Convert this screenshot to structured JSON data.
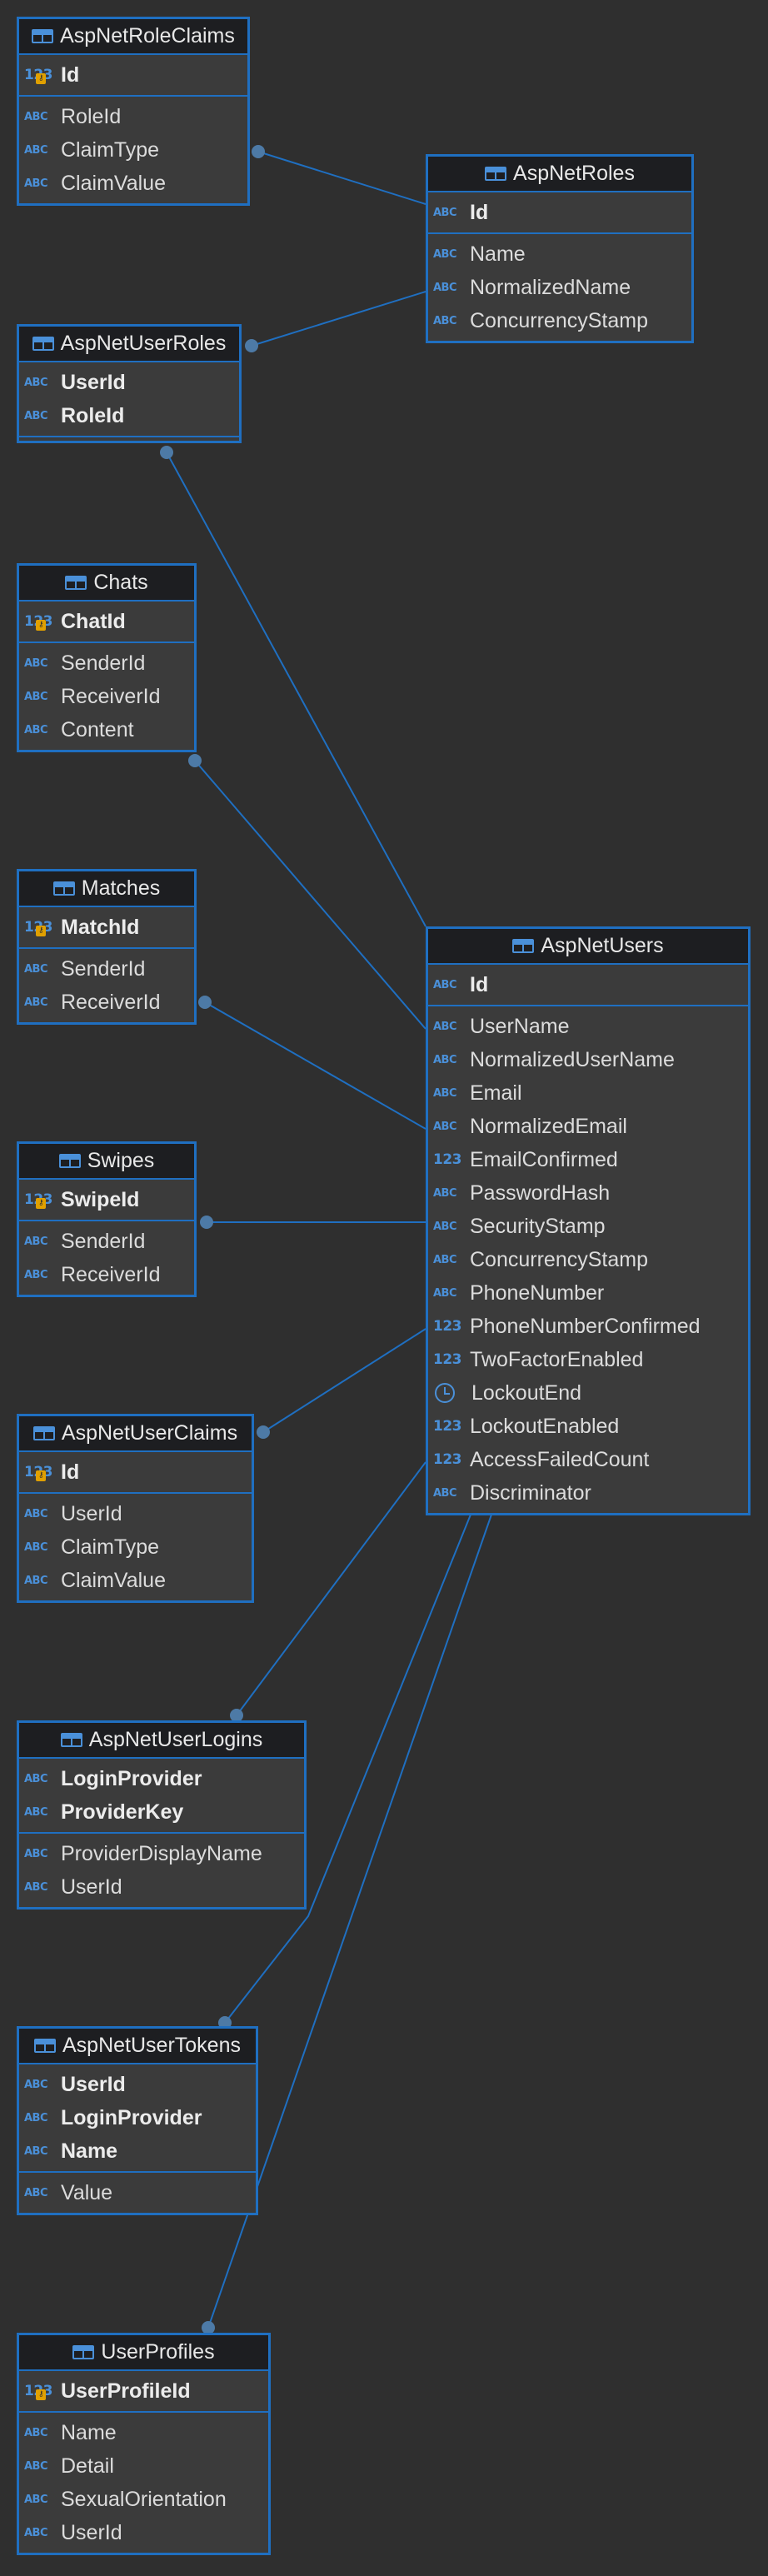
{
  "entities": [
    {
      "id": "AspNetRoleClaims",
      "name": "AspNetRoleClaims",
      "sections": [
        [
          {
            "name": "Id",
            "type": "123",
            "pk": true,
            "key": true
          }
        ],
        [
          {
            "name": "RoleId",
            "type": "ABC"
          },
          {
            "name": "ClaimType",
            "type": "ABC"
          },
          {
            "name": "ClaimValue",
            "type": "ABC"
          }
        ]
      ]
    },
    {
      "id": "AspNetRoles",
      "name": "AspNetRoles",
      "sections": [
        [
          {
            "name": "Id",
            "type": "ABC",
            "pk": true
          }
        ],
        [
          {
            "name": "Name",
            "type": "ABC"
          },
          {
            "name": "NormalizedName",
            "type": "ABC"
          },
          {
            "name": "ConcurrencyStamp",
            "type": "ABC"
          }
        ]
      ]
    },
    {
      "id": "AspNetUserRoles",
      "name": "AspNetUserRoles",
      "sections": [
        [
          {
            "name": "UserId",
            "type": "ABC",
            "pk": true
          },
          {
            "name": "RoleId",
            "type": "ABC",
            "pk": true
          }
        ],
        []
      ]
    },
    {
      "id": "Chats",
      "name": "Chats",
      "sections": [
        [
          {
            "name": "ChatId",
            "type": "123",
            "pk": true,
            "key": true
          }
        ],
        [
          {
            "name": "SenderId",
            "type": "ABC"
          },
          {
            "name": "ReceiverId",
            "type": "ABC"
          },
          {
            "name": "Content",
            "type": "ABC"
          }
        ]
      ]
    },
    {
      "id": "Matches",
      "name": "Matches",
      "sections": [
        [
          {
            "name": "MatchId",
            "type": "123",
            "pk": true,
            "key": true
          }
        ],
        [
          {
            "name": "SenderId",
            "type": "ABC"
          },
          {
            "name": "ReceiverId",
            "type": "ABC"
          }
        ]
      ]
    },
    {
      "id": "Swipes",
      "name": "Swipes",
      "sections": [
        [
          {
            "name": "SwipeId",
            "type": "123",
            "pk": true,
            "key": true
          }
        ],
        [
          {
            "name": "SenderId",
            "type": "ABC"
          },
          {
            "name": "ReceiverId",
            "type": "ABC"
          }
        ]
      ]
    },
    {
      "id": "AspNetUserClaims",
      "name": "AspNetUserClaims",
      "sections": [
        [
          {
            "name": "Id",
            "type": "123",
            "pk": true,
            "key": true
          }
        ],
        [
          {
            "name": "UserId",
            "type": "ABC"
          },
          {
            "name": "ClaimType",
            "type": "ABC"
          },
          {
            "name": "ClaimValue",
            "type": "ABC"
          }
        ]
      ]
    },
    {
      "id": "AspNetUserLogins",
      "name": "AspNetUserLogins",
      "sections": [
        [
          {
            "name": "LoginProvider",
            "type": "ABC",
            "pk": true
          },
          {
            "name": "ProviderKey",
            "type": "ABC",
            "pk": true
          }
        ],
        [
          {
            "name": "ProviderDisplayName",
            "type": "ABC"
          },
          {
            "name": "UserId",
            "type": "ABC"
          }
        ]
      ]
    },
    {
      "id": "AspNetUserTokens",
      "name": "AspNetUserTokens",
      "sections": [
        [
          {
            "name": "UserId",
            "type": "ABC",
            "pk": true
          },
          {
            "name": "LoginProvider",
            "type": "ABC",
            "pk": true
          },
          {
            "name": "Name",
            "type": "ABC",
            "pk": true
          }
        ],
        [
          {
            "name": "Value",
            "type": "ABC"
          }
        ]
      ]
    },
    {
      "id": "UserProfiles",
      "name": "UserProfiles",
      "sections": [
        [
          {
            "name": "UserProfileId",
            "type": "123",
            "pk": true,
            "key": true
          }
        ],
        [
          {
            "name": "Name",
            "type": "ABC"
          },
          {
            "name": "Detail",
            "type": "ABC"
          },
          {
            "name": "SexualOrientation",
            "type": "ABC"
          },
          {
            "name": "UserId",
            "type": "ABC"
          }
        ]
      ]
    },
    {
      "id": "AspNetUsers",
      "name": "AspNetUsers",
      "sections": [
        [
          {
            "name": "Id",
            "type": "ABC",
            "pk": true
          }
        ],
        [
          {
            "name": "UserName",
            "type": "ABC"
          },
          {
            "name": "NormalizedUserName",
            "type": "ABC"
          },
          {
            "name": "Email",
            "type": "ABC"
          },
          {
            "name": "NormalizedEmail",
            "type": "ABC"
          },
          {
            "name": "EmailConfirmed",
            "type": "123"
          },
          {
            "name": "PasswordHash",
            "type": "ABC"
          },
          {
            "name": "SecurityStamp",
            "type": "ABC"
          },
          {
            "name": "ConcurrencyStamp",
            "type": "ABC"
          },
          {
            "name": "PhoneNumber",
            "type": "ABC"
          },
          {
            "name": "PhoneNumberConfirmed",
            "type": "123"
          },
          {
            "name": "TwoFactorEnabled",
            "type": "123"
          },
          {
            "name": "LockoutEnd",
            "type": "clock"
          },
          {
            "name": "LockoutEnabled",
            "type": "123"
          },
          {
            "name": "AccessFailedCount",
            "type": "123"
          },
          {
            "name": "Discriminator",
            "type": "ABC"
          }
        ]
      ]
    }
  ],
  "relations": [
    {
      "from": "AspNetRoleClaims",
      "to": "AspNetRoles"
    },
    {
      "from": "AspNetUserRoles",
      "to": "AspNetRoles"
    },
    {
      "from": "AspNetUserRoles",
      "to": "AspNetUsers"
    },
    {
      "from": "Chats",
      "to": "AspNetUsers"
    },
    {
      "from": "Matches",
      "to": "AspNetUsers"
    },
    {
      "from": "Swipes",
      "to": "AspNetUsers"
    },
    {
      "from": "AspNetUserClaims",
      "to": "AspNetUsers"
    },
    {
      "from": "AspNetUserLogins",
      "to": "AspNetUsers"
    },
    {
      "from": "AspNetUserTokens",
      "to": "AspNetUsers"
    },
    {
      "from": "UserProfiles",
      "to": "AspNetUsers"
    }
  ],
  "colors": {
    "border": "#1f6fc1",
    "header": "#1d1e21",
    "body": "#3b3b3b",
    "line": "#1f6fc1",
    "dot": "#4d7aa6",
    "background": "#2f2f2f"
  }
}
